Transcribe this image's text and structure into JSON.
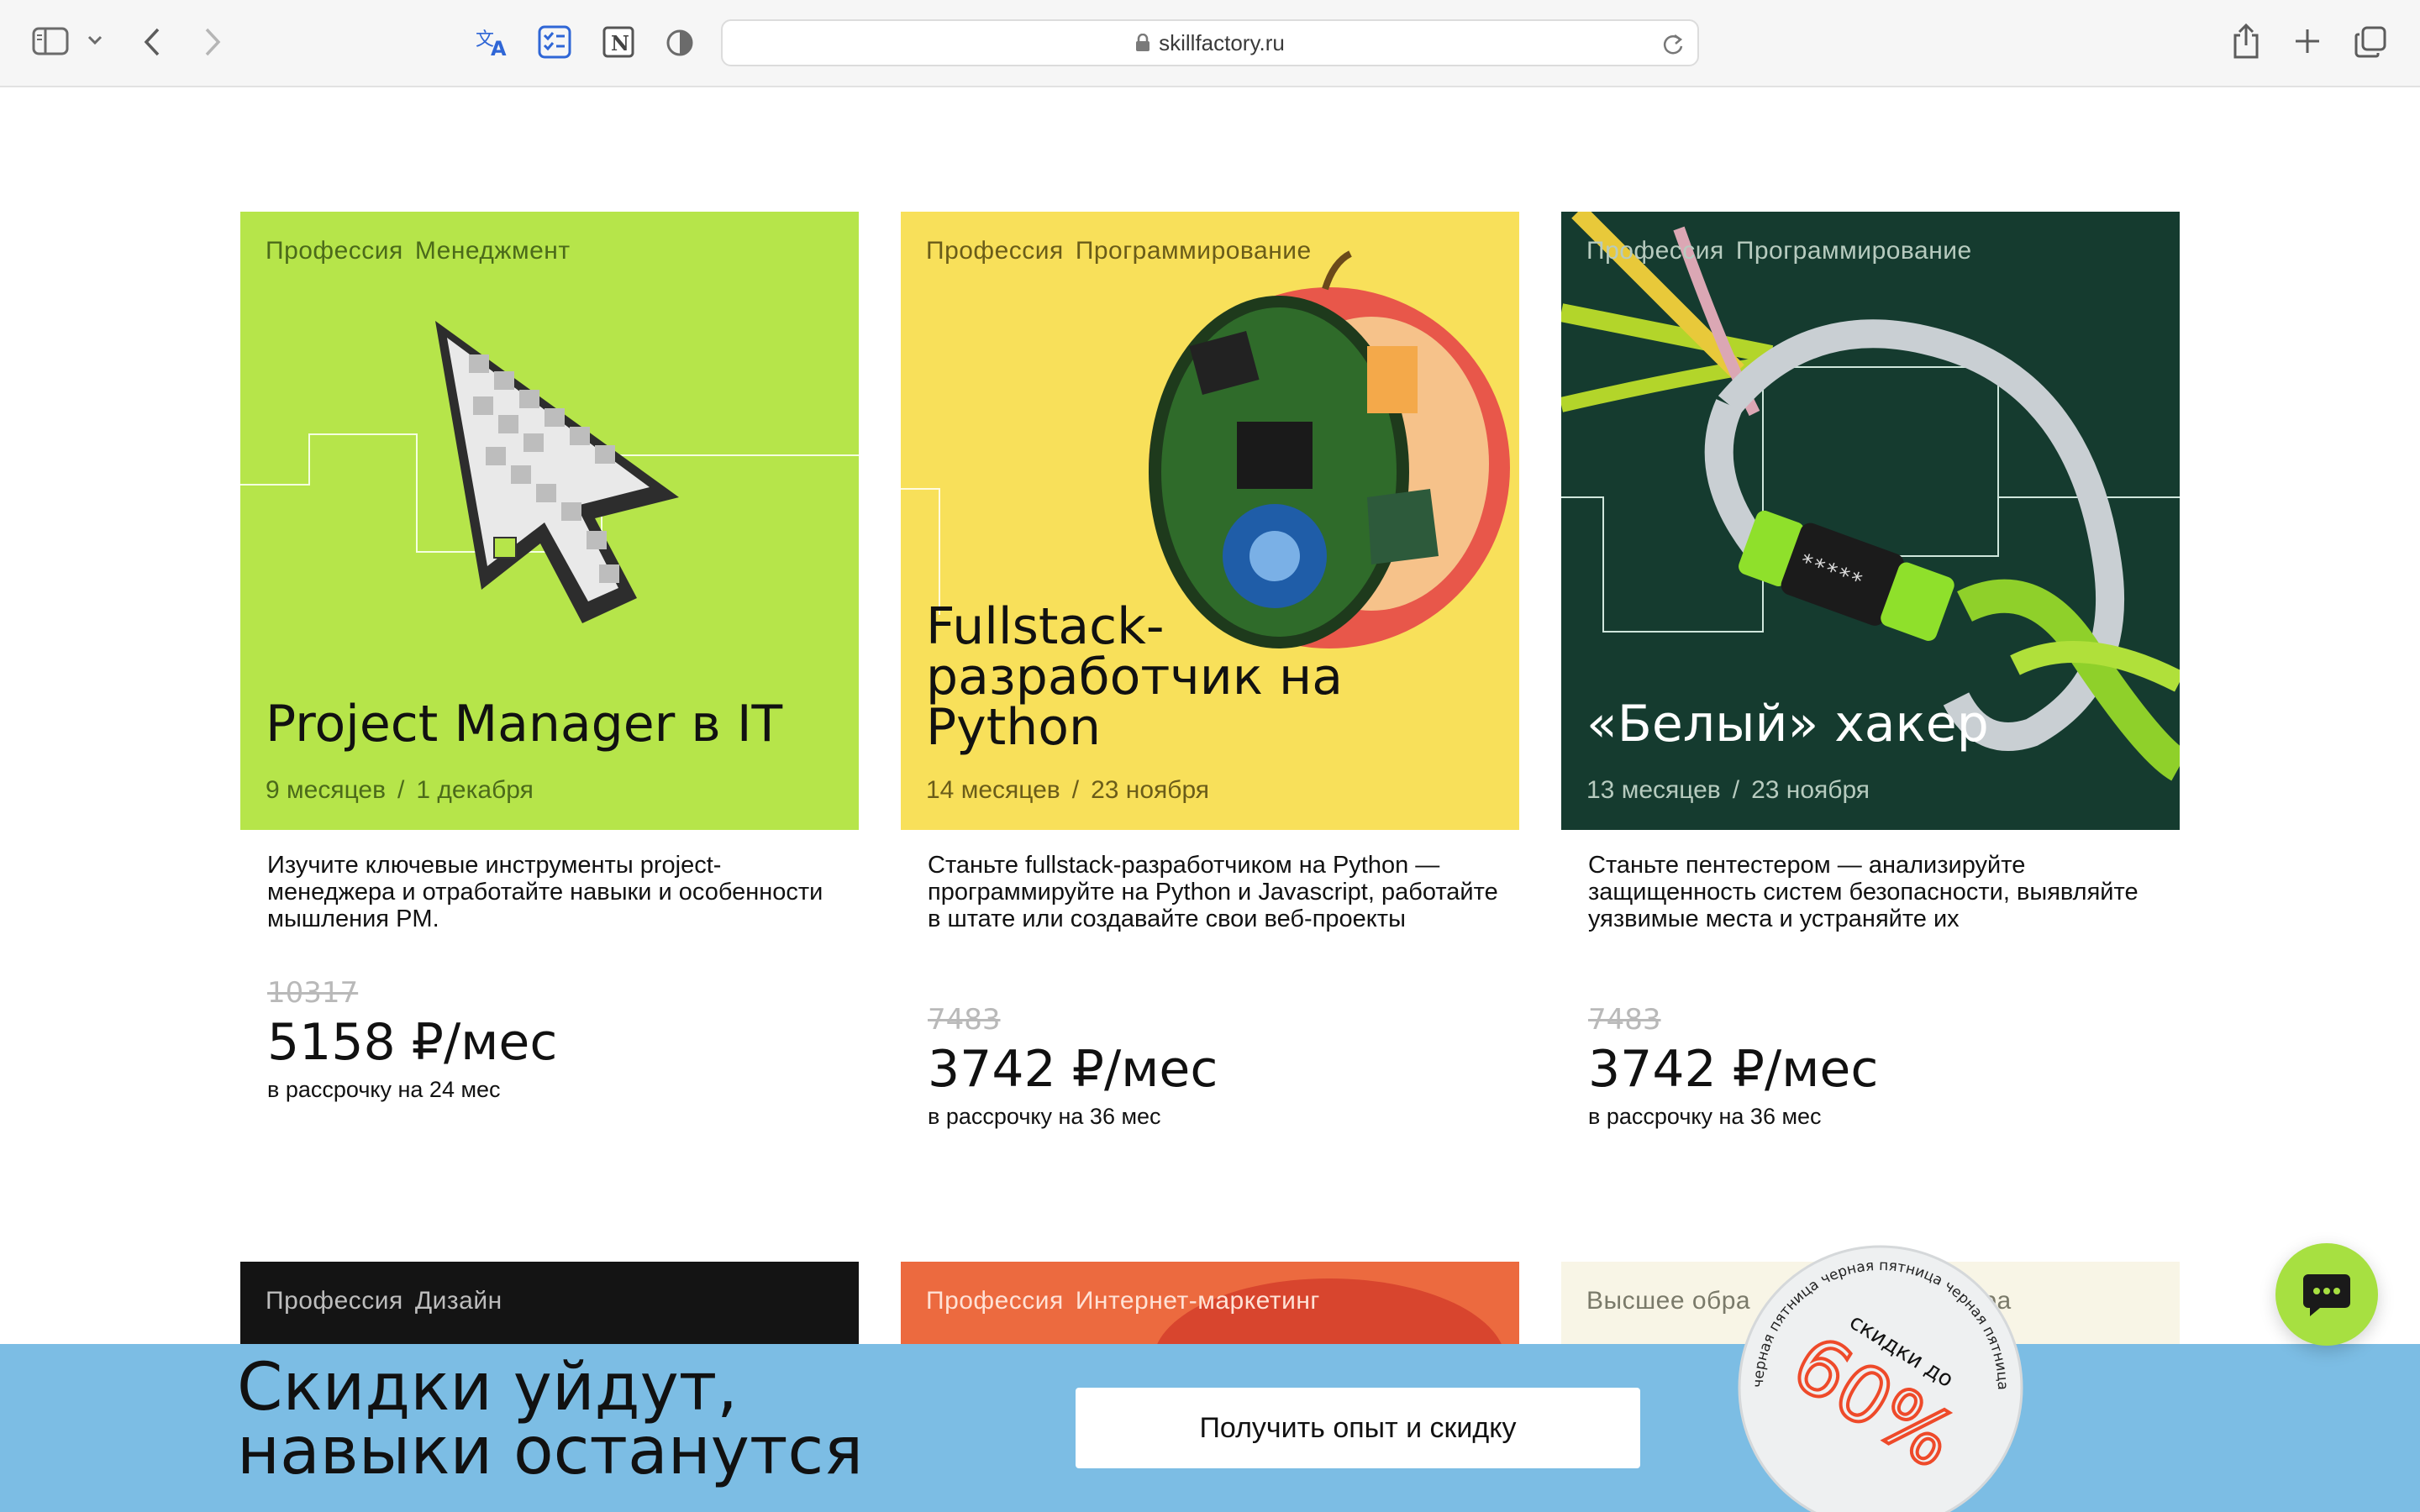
{
  "browser": {
    "url": "skillfactory.ru",
    "icons": [
      "sidebar-icon",
      "chevron-down-icon",
      "back-icon",
      "forward-icon",
      "translate-icon",
      "tasks-icon",
      "notion-icon",
      "privacy-shield-icon",
      "lock-icon",
      "reload-icon",
      "share-icon",
      "new-tab-icon",
      "tabs-overview-icon"
    ]
  },
  "cards": [
    {
      "category": "Профессия",
      "field": "Менеджмент",
      "title": "Project Manager в IT",
      "duration": "9 месяцев",
      "separator": "/",
      "start": "1 декабря",
      "description": "Изучите ключевые инструменты project-менеджера и отработайте навыки и особенности мышления PM.",
      "old_price": "10317",
      "price": "5158 ₽/мес",
      "installment": "в рассрочку на 24 мес",
      "bg_color": "#b6e54a"
    },
    {
      "category": "Профессия",
      "field": "Программирование",
      "title": "Fullstack-\nразработчик на\nPython",
      "duration": "14 месяцев",
      "separator": "/",
      "start": "23 ноября",
      "description": "Станьте fullstack-разработчиком на Python — программируйте на Python и Javascript, работайте в штате или создавайте свои веб-проекты",
      "old_price": "7483",
      "price": "3742 ₽/мес",
      "installment": "в рассрочку на 36 мес",
      "bg_color": "#f8e05a"
    },
    {
      "category": "Профессия",
      "field": "Программирование",
      "title": "«Белый» хакер",
      "duration": "13 месяцев",
      "separator": "/",
      "start": "23 ноября",
      "description": "Станьте пентестером — анализируйте защищенность систем безопасности, выявляйте уязвимые места и устраняйте их",
      "old_price": "7483",
      "price": "3742 ₽/мес",
      "installment": "в рассрочку на 36 мес",
      "bg_color": "#153b2f"
    }
  ],
  "cards_row2": [
    {
      "category": "Профессия",
      "field": "Дизайн",
      "bg_color": "#141414"
    },
    {
      "category": "Профессия",
      "field": "Интернет-маркетинг",
      "bg_color": "#ec6a3f"
    },
    {
      "category": "Высшее обра",
      "field": "атура",
      "bg_color": "#f8f5e6"
    }
  ],
  "banner": {
    "text": "Скидки уйдут,\nнавыки останутся",
    "button_label": "Получить опыт и скидку",
    "bg_color": "#7cbde4"
  },
  "stamp": {
    "ring_text": "черная пятница черная пятница черная пятница",
    "label": "скидки до",
    "discount": "60%"
  },
  "chat": {
    "icon": "chat-bubble-icon",
    "accent": "#a7e041"
  }
}
